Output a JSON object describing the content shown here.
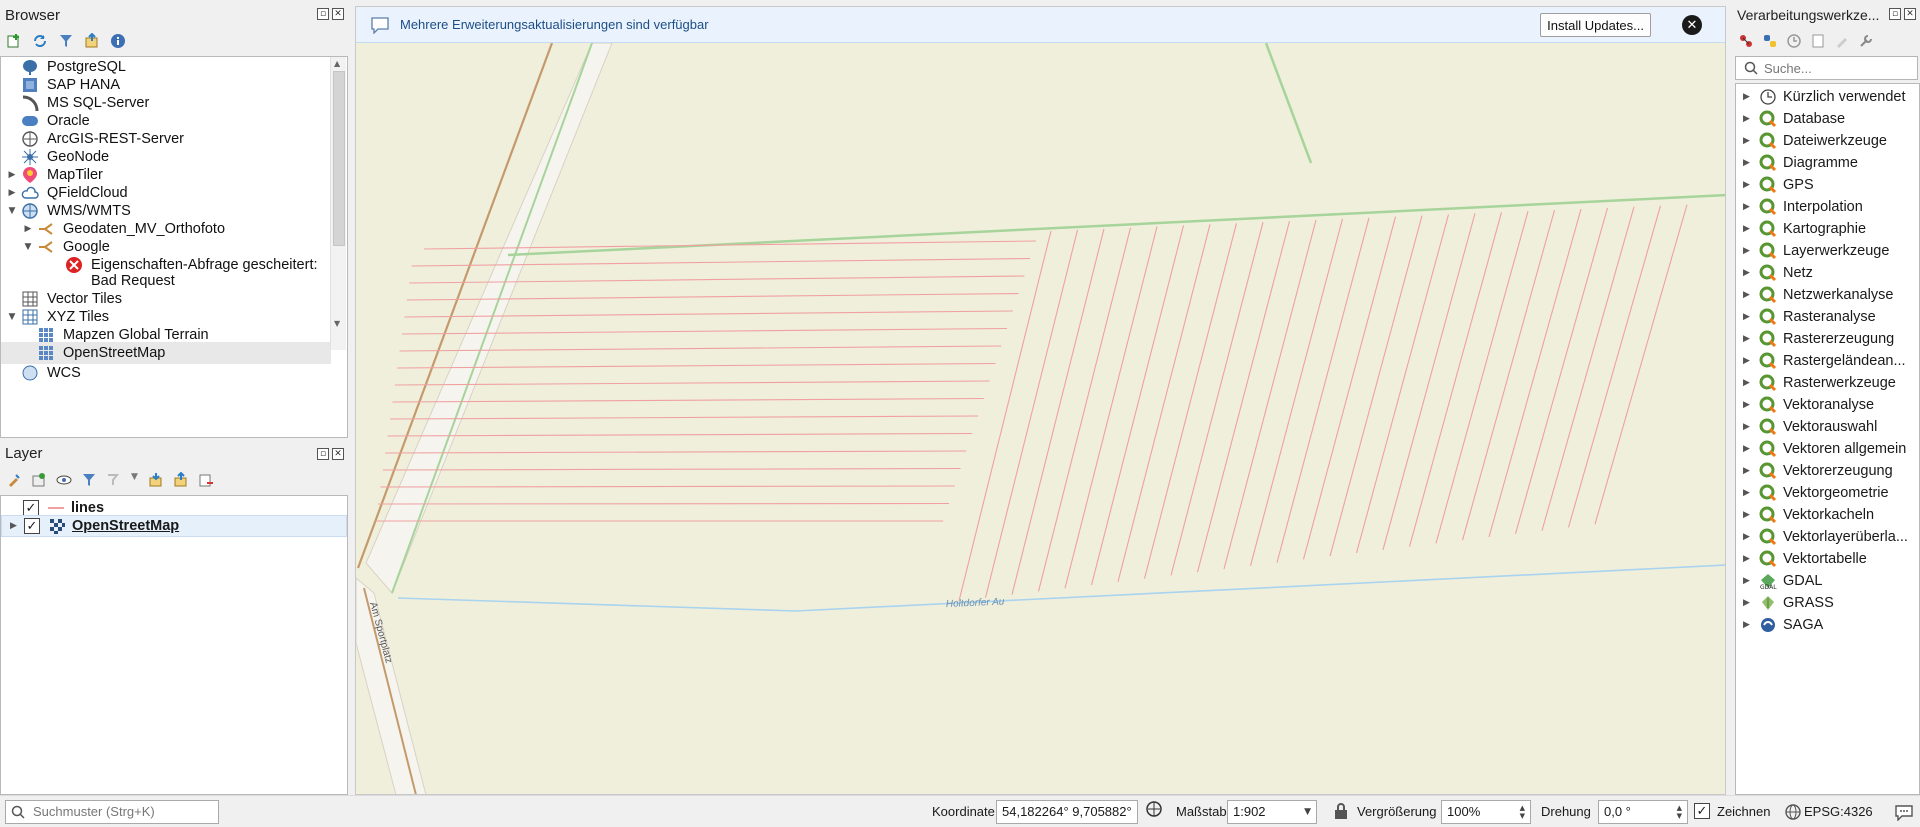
{
  "browser": {
    "title": "Browser",
    "items": [
      {
        "label": "PostgreSQL",
        "icon": "postgresql-icon",
        "arrow": "",
        "indent": 0
      },
      {
        "label": "SAP HANA",
        "icon": "sap-hana-icon",
        "arrow": "",
        "indent": 0
      },
      {
        "label": "MS SQL-Server",
        "icon": "mssql-icon",
        "arrow": "",
        "indent": 0
      },
      {
        "label": "Oracle",
        "icon": "oracle-icon",
        "arrow": "",
        "indent": 0
      },
      {
        "label": "ArcGIS-REST-Server",
        "icon": "arcgis-icon",
        "arrow": "",
        "indent": 0
      },
      {
        "label": "GeoNode",
        "icon": "geonode-icon",
        "arrow": "",
        "indent": 0
      },
      {
        "label": "MapTiler",
        "icon": "maptiler-icon",
        "arrow": "▶",
        "indent": 0
      },
      {
        "label": "QFieldCloud",
        "icon": "cloud-icon",
        "arrow": "▶",
        "indent": 0
      },
      {
        "label": "WMS/WMTS",
        "icon": "globe-icon",
        "arrow": "▼",
        "indent": 0
      },
      {
        "label": "Geodaten_MV_Orthofoto",
        "icon": "connection-icon",
        "arrow": "▶",
        "indent": 1
      },
      {
        "label": "Google",
        "icon": "connection-icon",
        "arrow": "▼",
        "indent": 1
      },
      {
        "label": "Eigenschaften-Abfrage gescheitert:",
        "icon": "error-icon",
        "arrow": "",
        "indent": 2
      },
      {
        "label": "Bad Request",
        "icon": "",
        "arrow": "",
        "indent": 2
      },
      {
        "label": "Vector Tiles",
        "icon": "vector-tiles-icon",
        "arrow": "",
        "indent": 0
      },
      {
        "label": "XYZ Tiles",
        "icon": "xyz-tiles-icon",
        "arrow": "▼",
        "indent": 0
      },
      {
        "label": "Mapzen Global Terrain",
        "icon": "tile-grid-icon",
        "arrow": "",
        "indent": 1
      },
      {
        "label": "OpenStreetMap",
        "icon": "tile-grid-icon",
        "arrow": "",
        "indent": 1,
        "selected": true
      },
      {
        "label": "WCS",
        "icon": "wcs-icon",
        "arrow": "",
        "indent": 0
      }
    ]
  },
  "layers": {
    "title": "Layer",
    "items": [
      {
        "label": "lines",
        "checked": true,
        "icon": "line-symbol-icon",
        "selected": false
      },
      {
        "label": "OpenStreetMap",
        "checked": true,
        "icon": "raster-layer-icon",
        "selected": true
      }
    ]
  },
  "message_bar": {
    "text": "Mehrere Erweiterungsaktualisierungen sind verfügbar",
    "install_button": "Install Updates...",
    "close_label": "✕"
  },
  "map": {
    "street_label_1": "Am Sportplatz",
    "street_label_2": "Holtdorfer Au",
    "colors": {
      "background": "#f0efdc",
      "lines": "#f0a0a0",
      "road": "#c49a6c",
      "water": "#a9d3ef",
      "boundary": "#a6d49a"
    }
  },
  "processing": {
    "title": "Verarbeitungswerkze...",
    "search_placeholder": "Suche...",
    "items": [
      {
        "label": "Kürzlich verwendet",
        "icon": "clock-icon"
      },
      {
        "label": "Database",
        "icon": "qgis-icon"
      },
      {
        "label": "Dateiwerkzeuge",
        "icon": "qgis-icon"
      },
      {
        "label": "Diagramme",
        "icon": "qgis-icon"
      },
      {
        "label": "GPS",
        "icon": "qgis-icon"
      },
      {
        "label": "Interpolation",
        "icon": "qgis-icon"
      },
      {
        "label": "Kartographie",
        "icon": "qgis-icon"
      },
      {
        "label": "Layerwerkzeuge",
        "icon": "qgis-icon"
      },
      {
        "label": "Netz",
        "icon": "qgis-icon"
      },
      {
        "label": "Netzwerkanalyse",
        "icon": "qgis-icon"
      },
      {
        "label": "Rasteranalyse",
        "icon": "qgis-icon"
      },
      {
        "label": "Rastererzeugung",
        "icon": "qgis-icon"
      },
      {
        "label": "Rastergeländean...",
        "icon": "qgis-icon"
      },
      {
        "label": "Rasterwerkzeuge",
        "icon": "qgis-icon"
      },
      {
        "label": "Vektoranalyse",
        "icon": "qgis-icon"
      },
      {
        "label": "Vektorauswahl",
        "icon": "qgis-icon"
      },
      {
        "label": "Vektoren allgemein",
        "icon": "qgis-icon"
      },
      {
        "label": "Vektorerzeugung",
        "icon": "qgis-icon"
      },
      {
        "label": "Vektorgeometrie",
        "icon": "qgis-icon"
      },
      {
        "label": "Vektorkacheln",
        "icon": "qgis-icon"
      },
      {
        "label": "Vektorlayerüberla...",
        "icon": "qgis-icon"
      },
      {
        "label": "Vektortabelle",
        "icon": "qgis-icon"
      },
      {
        "label": "GDAL",
        "icon": "gdal-icon"
      },
      {
        "label": "GRASS",
        "icon": "grass-icon"
      },
      {
        "label": "SAGA",
        "icon": "saga-icon"
      }
    ]
  },
  "status": {
    "search_placeholder": "Suchmuster (Strg+K)",
    "coord_label": "Koordinate",
    "coord_value": "54,182264° 9,705882°",
    "scale_label": "Maßstab",
    "scale_value": "1:902",
    "magnifier_label": "Vergrößerung",
    "magnifier_value": "100%",
    "rotation_label": "Drehung",
    "rotation_value": "0,0 °",
    "render_label": "Zeichnen",
    "crs_label": "EPSG:4326"
  }
}
